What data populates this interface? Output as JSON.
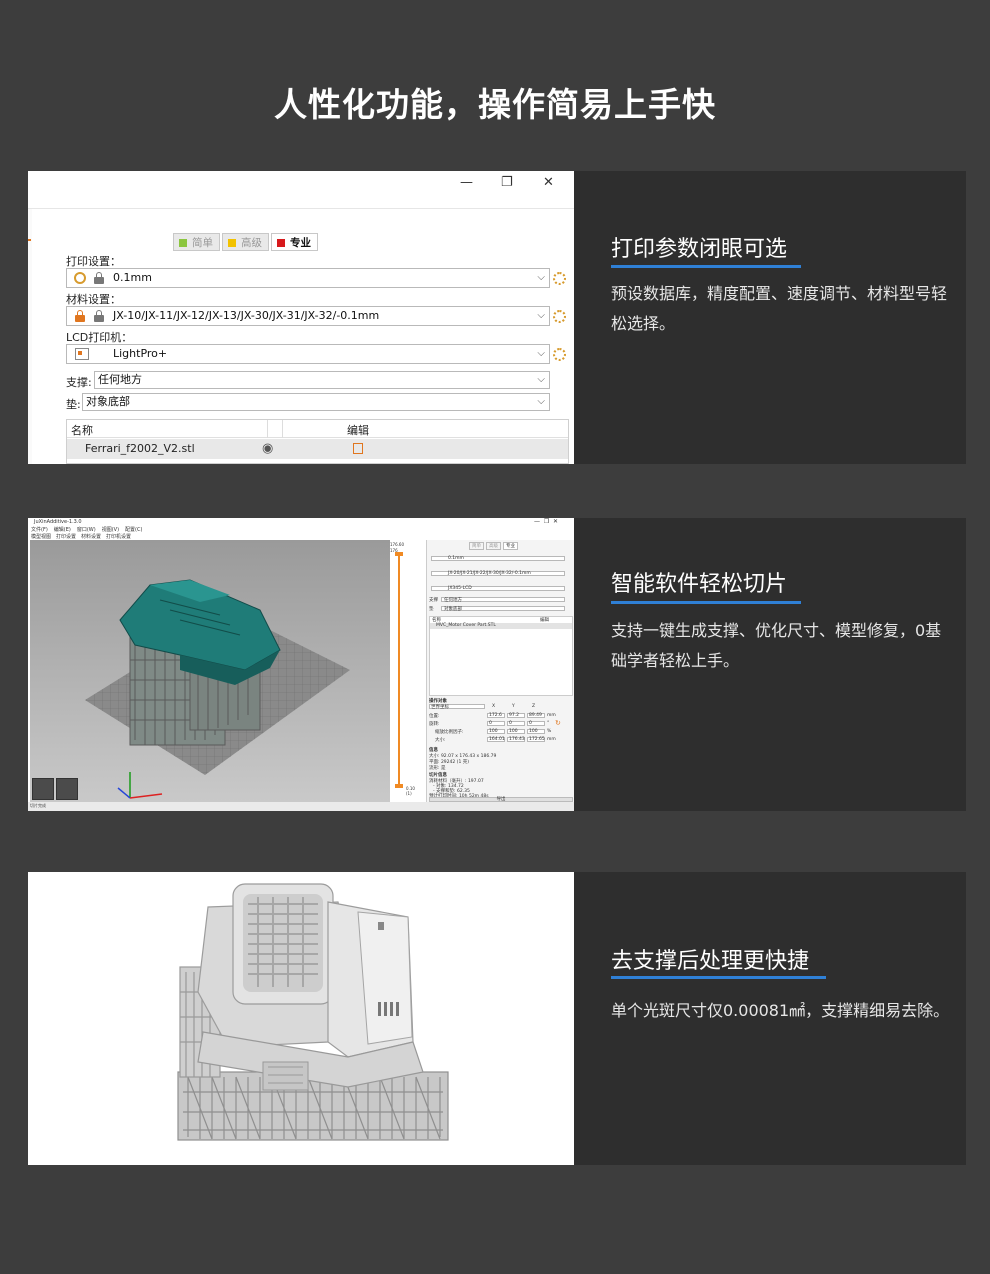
{
  "page": {
    "title": "人性化功能，操作简易上手快"
  },
  "features": [
    {
      "title": "打印参数闭眼可选",
      "desc": "预设数据库，精度配置、速度调节、材料型号轻松选择。"
    },
    {
      "title": "智能软件轻松切片",
      "desc": "支持一键生成支撑、优化尺寸、模型修复，0基础学者轻松上手。"
    },
    {
      "title": "去支撑后处理更快捷",
      "desc": "单个光斑尺寸仅0.00081㎟，支撑精细易去除。"
    }
  ],
  "screenshot1": {
    "window_buttons": {
      "minimize": "—",
      "restore": "❐",
      "close": "✕"
    },
    "modes": [
      {
        "label": "简单",
        "color": "#8cc63f",
        "active": false
      },
      {
        "label": "高级",
        "color": "#f2c200",
        "active": false
      },
      {
        "label": "专业",
        "color": "#d7191c",
        "active": true
      }
    ],
    "print_settings_label": "打印设置：",
    "print_settings_value": "0.1mm",
    "material_label": "材料设置：",
    "material_value": "JX-10/JX-11/JX-12/JX-13/JX-30/JX-31/JX-32/-0.1mm",
    "printer_label": "LCD打印机：",
    "printer_value": "LightPro+",
    "support_label": "支撑:",
    "support_value": "任何地方",
    "pad_label": "垫:",
    "pad_value": "对象底部",
    "table": {
      "col_name": "名称",
      "col_edit": "编辑",
      "row_name": "Ferrari_f2002_V2.stl"
    }
  },
  "screenshot2": {
    "app_title": "JuXinAdditive-1.3.0",
    "menus": [
      "文件(F)",
      "编辑(E)",
      "窗口(W)",
      "视图(V)",
      "配置(C)"
    ],
    "tabs": [
      "模型视图",
      "打印设置",
      "材料设置",
      "打印机设置"
    ],
    "top_value": "176.60",
    "top_value2": "176",
    "bottom_value": "0.10",
    "bottom_value2": "(1)",
    "panel_mode_labels": [
      "简单",
      "高级",
      "专业"
    ],
    "print_value": "0.1mm",
    "material_value": "JX-20/JX-21/JX-22/JX-30/JX-32/-0.1mm",
    "printer_value": "JX345-LCD",
    "support_label": "支撑",
    "support_value": "任何地方",
    "pad_label": "垫",
    "pad_value": "对象底部",
    "table_col_name": "名称",
    "table_col_edit": "编辑",
    "model_name": "MVC_Motor Cover Part.STL",
    "ops_title": "操作对象",
    "coord_system": "世界坐标",
    "axis_labels": [
      "X",
      "Y",
      "Z"
    ],
    "position_label": "位置:",
    "position": [
      "172.6",
      "97.2",
      "89.49"
    ],
    "rotation_label": "旋转:",
    "rotation": [
      "0",
      "0",
      "0"
    ],
    "scale_label": "缩放比例因子:",
    "scale": [
      "100",
      "100",
      "100"
    ],
    "size_label": "大小:",
    "size": [
      "164.01",
      "176.43",
      "172.65"
    ],
    "unit_mm": "mm",
    "unit_deg": "°",
    "unit_pct": "%",
    "info_title": "信息",
    "info_size": "大小:  92.07 x 176.43 x 186.79",
    "info_faces": "平面:  29242 (1 壳)",
    "info_manifold": "流形: 是",
    "slice_title": "切片信息",
    "slice_material": "消耗材料（毫升）:   197.07",
    "slice_object": "- 对象:   134.72",
    "slice_support": "- 支撑和垫:   62.35",
    "slice_time": "预计打印时间:   10h 52m 48s",
    "slice_button": "导出",
    "status_text": "切片完成"
  }
}
